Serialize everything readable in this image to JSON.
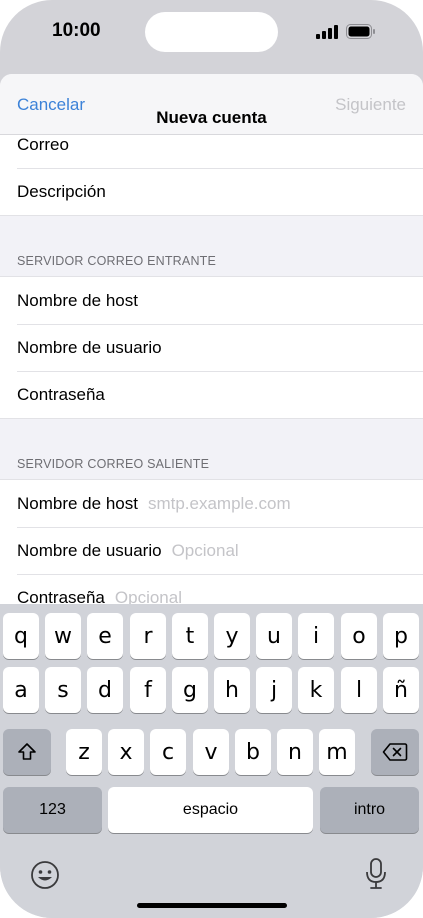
{
  "status_bar": {
    "time": "10:00"
  },
  "nav": {
    "cancel": "Cancelar",
    "title": "Nueva cuenta",
    "next": "Siguiente"
  },
  "account_group": {
    "rows": [
      {
        "label": "Correo"
      },
      {
        "label": "Descripción"
      }
    ]
  },
  "incoming": {
    "header": "SERVIDOR CORREO ENTRANTE",
    "rows": [
      {
        "label": "Nombre de host"
      },
      {
        "label": "Nombre de usuario"
      },
      {
        "label": "Contraseña"
      }
    ]
  },
  "outgoing": {
    "header": "SERVIDOR CORREO SALIENTE",
    "rows": [
      {
        "label": "Nombre de host",
        "placeholder": "smtp.example.com"
      },
      {
        "label": "Nombre de usuario",
        "placeholder": "Opcional"
      },
      {
        "label": "Contraseña",
        "placeholder": "Opcional"
      }
    ]
  },
  "keyboard": {
    "row1": [
      "q",
      "w",
      "e",
      "r",
      "t",
      "y",
      "u",
      "i",
      "o",
      "p"
    ],
    "row2": [
      "a",
      "s",
      "d",
      "f",
      "g",
      "h",
      "j",
      "k",
      "l",
      "ñ"
    ],
    "row3": [
      "z",
      "x",
      "c",
      "v",
      "b",
      "n",
      "m"
    ],
    "numbers": "123",
    "space": "espacio",
    "return": "intro",
    "icons": {
      "shift": "shift-icon",
      "delete": "delete-icon",
      "emoji": "emoji-icon",
      "mic": "microphone-icon"
    }
  },
  "colors": {
    "accent": "#3c82d8",
    "placeholder": "#c4c4c8",
    "disabled": "#c4c4c8"
  }
}
